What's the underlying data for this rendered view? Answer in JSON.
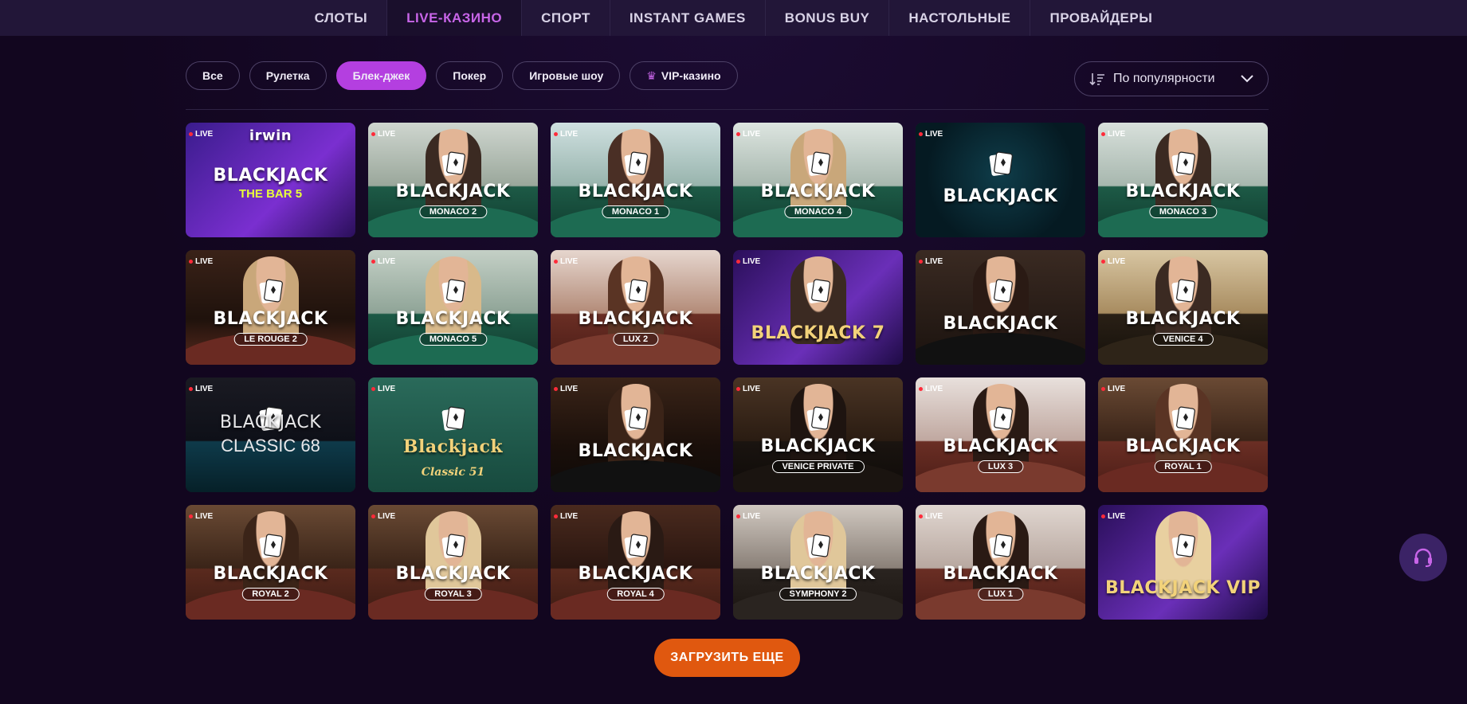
{
  "nav": {
    "items": [
      {
        "label": "СЛОТЫ",
        "active": false
      },
      {
        "label": "LIVE-КАЗИНО",
        "active": true
      },
      {
        "label": "СПОРТ",
        "active": false
      },
      {
        "label": "INSTANT GAMES",
        "active": false
      },
      {
        "label": "BONUS BUY",
        "active": false
      },
      {
        "label": "НАСТОЛЬНЫЕ",
        "active": false
      },
      {
        "label": "ПРОВАЙДЕРЫ",
        "active": false
      }
    ]
  },
  "filters": {
    "items": [
      {
        "label": "Все",
        "active": false
      },
      {
        "label": "Рулетка",
        "active": false
      },
      {
        "label": "Блек-джек",
        "active": true
      },
      {
        "label": "Покер",
        "active": false
      },
      {
        "label": "Игровые шоу",
        "active": false
      },
      {
        "label": "VIP-казино",
        "active": false,
        "icon": "crown-icon"
      }
    ]
  },
  "sort": {
    "label": "По популярности",
    "icon": "sort-icon"
  },
  "games": [
    {
      "badge": "LIVE",
      "brand": "irwin",
      "title": "BLACKJACK",
      "sub": "THE BAR 5"
    },
    {
      "badge": "LIVE",
      "title": "BLACKJACK",
      "sub": "MONACO 2"
    },
    {
      "badge": "LIVE",
      "title": "BLACKJACK",
      "sub": "MONACO 1"
    },
    {
      "badge": "LIVE",
      "title": "BLACKJACK",
      "sub": "MONACO 4"
    },
    {
      "badge": "LIVE",
      "title": "BLACKJACK",
      "sub": ""
    },
    {
      "badge": "LIVE",
      "title": "BLACKJACK",
      "sub": "MONACO 3"
    },
    {
      "badge": "LIVE",
      "title": "BLACKJACK",
      "sub": "LE ROUGE 2"
    },
    {
      "badge": "LIVE",
      "title": "BLACKJACK",
      "sub": "MONACO 5"
    },
    {
      "badge": "LIVE",
      "title": "BLACKJACK",
      "sub": "LUX 2"
    },
    {
      "badge": "LIVE",
      "title": "BLACKJACK 7",
      "sub": ""
    },
    {
      "badge": "LIVE",
      "title": "BLACKJACK",
      "sub": ""
    },
    {
      "badge": "LIVE",
      "title": "BLACKJACK",
      "sub": "VENICE 4"
    },
    {
      "badge": "LIVE",
      "title": "BLACKJACK",
      "sub": "CLASSIC 68"
    },
    {
      "badge": "LIVE",
      "title": "Blackjack",
      "sub": "Classic 51"
    },
    {
      "badge": "LIVE",
      "title": "BLACKJACK",
      "sub": ""
    },
    {
      "badge": "LIVE",
      "title": "BLACKJACK",
      "sub": "VENICE PRIVATE"
    },
    {
      "badge": "LIVE",
      "title": "BLACKJACK",
      "sub": "LUX 3"
    },
    {
      "badge": "LIVE",
      "title": "BLACKJACK",
      "sub": "ROYAL 1"
    },
    {
      "badge": "LIVE",
      "title": "BLACKJACK",
      "sub": "ROYAL 2"
    },
    {
      "badge": "LIVE",
      "title": "BLACKJACK",
      "sub": "ROYAL 3"
    },
    {
      "badge": "LIVE",
      "title": "BLACKJACK",
      "sub": "ROYAL 4"
    },
    {
      "badge": "LIVE",
      "title": "BLACKJACK",
      "sub": "SYMPHONY 2"
    },
    {
      "badge": "LIVE",
      "title": "BLACKJACK",
      "sub": "LUX 1"
    },
    {
      "badge": "LIVE",
      "title": "BLACKJACK VIP",
      "sub": ""
    }
  ],
  "load_more": {
    "label": "ЗАГРУЗИТЬ ЕЩЕ"
  },
  "support": {
    "icon": "headset-icon"
  },
  "colors": {
    "accent": "#b43fe0",
    "nav_active": "#c865e8",
    "cta": "#e0580f",
    "live_dot": "#ff2b3a"
  }
}
